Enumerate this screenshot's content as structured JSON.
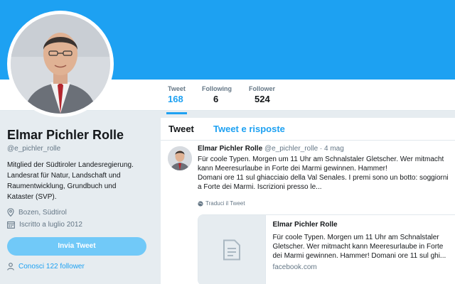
{
  "profile": {
    "name": "Elmar Pichler Rolle",
    "handle": "@e_pichler_rolle",
    "bio_lines": [
      "Mitglied der Südtiroler Landesregierung.",
      "Landesrat für Natur, Landschaft und",
      "Raumentwicklung, Grundbuch und",
      "Kataster (SVP)."
    ],
    "location": "Bozen, Südtirol",
    "joined": "Iscritto a luglio 2012",
    "tweet_button": "Invia Tweet",
    "followers_you_know": "Conosci 122 follower"
  },
  "stats": [
    {
      "label": "Tweet",
      "value": "168"
    },
    {
      "label": "Following",
      "value": "6"
    },
    {
      "label": "Follower",
      "value": "524"
    }
  ],
  "timeline_tabs": [
    "Tweet",
    "Tweet e risposte"
  ],
  "tweet": {
    "name": "Elmar Pichler Rolle",
    "handle_time": "@e_pichler_rolle · 4 mag",
    "text_lines": [
      "Für coole Typen. Morgen um 11 Uhr am Schnalstaler Gletscher. Wer mitmacht",
      "kann Meeresurlaube in Forte dei Marmi gewinnen. Hammer!",
      "Domani ore 11 sul ghiacciaio della Val Senales. I premi sono un botto: soggiorni",
      "a Forte dei Marmi. Iscrizioni presso le..."
    ],
    "translate": "Traduci il Tweet",
    "card": {
      "title": "Elmar Pichler Rolle",
      "desc_lines": [
        "Für coole Typen. Morgen um 11 Uhr am Schnalstaler",
        "Gletscher. Wer mitmacht kann Meeresurlaube in Forte",
        "dei Marmi gewinnen. Hammer! Domani ore 11 sul ghi..."
      ],
      "domain": "facebook.com"
    }
  },
  "icons": {
    "location": "map-pin-icon",
    "calendar": "calendar-icon",
    "followers": "person-icon",
    "globe": "globe-icon",
    "card": "document-icon"
  },
  "colors": {
    "banner": "#1da1f2",
    "accent": "#1da1f2",
    "tweet_button": "#71c9f8",
    "background": "#e6ecf0"
  }
}
